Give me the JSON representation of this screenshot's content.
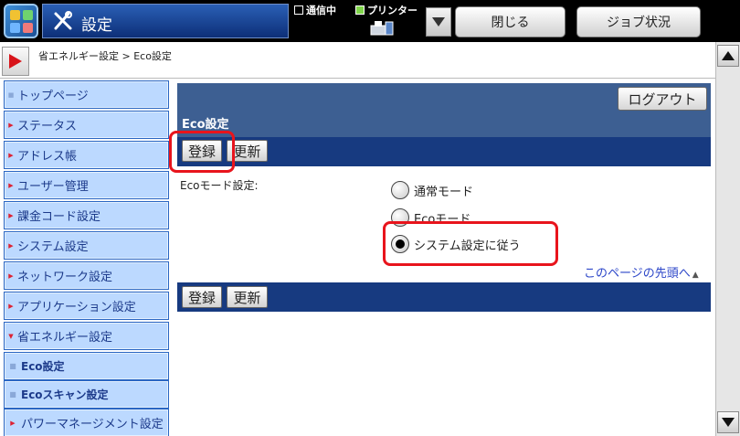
{
  "topbar": {
    "title": "設定",
    "comm_status": "通信中",
    "printer_status": "プリンター",
    "close_label": "閉じる",
    "job_status_label": "ジョブ状況"
  },
  "breadcrumb": {
    "text": "省エネルギー設定 > Eco設定"
  },
  "sidebar": {
    "items": [
      {
        "label": "トップページ"
      },
      {
        "label": "ステータス"
      },
      {
        "label": "アドレス帳"
      },
      {
        "label": "ユーザー管理"
      },
      {
        "label": "課金コード設定"
      },
      {
        "label": "システム設定"
      },
      {
        "label": "ネットワーク設定"
      },
      {
        "label": "アプリケーション設定"
      },
      {
        "label": "省エネルギー設定"
      },
      {
        "label": "Eco設定"
      },
      {
        "label": "Ecoスキャン設定"
      },
      {
        "label": "パワーマネージメント設定"
      }
    ]
  },
  "main": {
    "logout_label": "ログアウト",
    "panel_title": "Eco設定",
    "register_label": "登録",
    "refresh_label": "更新",
    "eco_mode_label": "Ecoモード設定:",
    "options": [
      {
        "label": "通常モード",
        "selected": false
      },
      {
        "label": "Ecoモード",
        "selected": false
      },
      {
        "label": "システム設定に従う",
        "selected": true
      }
    ],
    "page_top_link": "このページの先頭へ"
  },
  "colors": {
    "highlight": "#e8141c",
    "panel_bar": "#173a80",
    "sidebar_bg": "#bcd9ff"
  }
}
